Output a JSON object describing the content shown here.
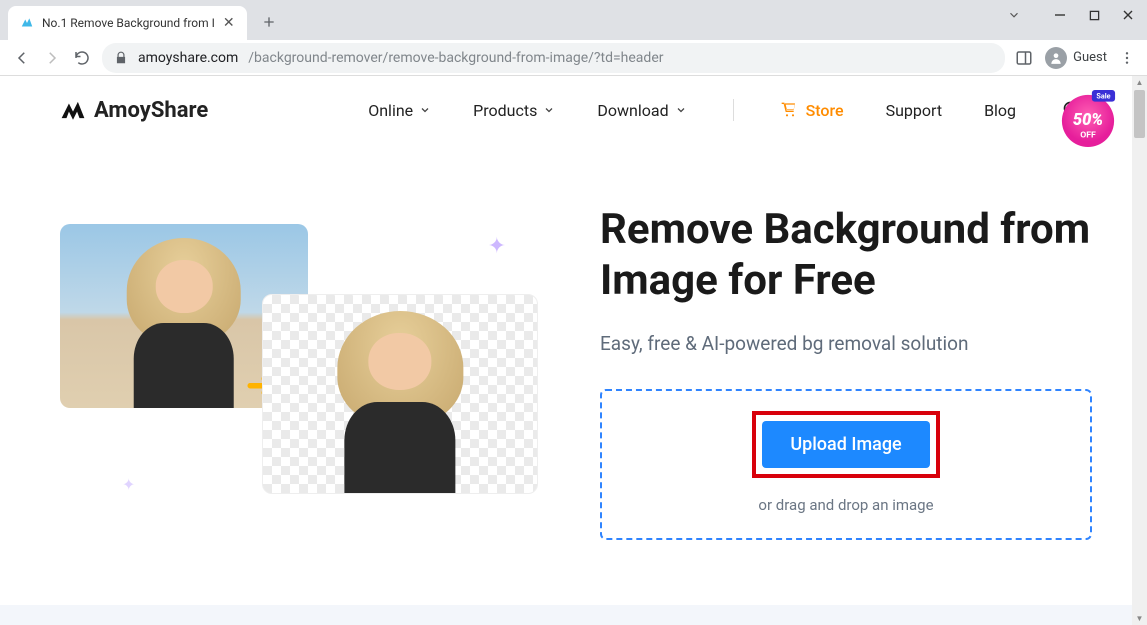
{
  "browser": {
    "tab_title": "No.1 Remove Background from I",
    "url_host": "amoyshare.com",
    "url_path": "/background-remover/remove-background-from-image/?td=header",
    "guest_label": "Guest"
  },
  "header": {
    "logo_text": "AmoyShare",
    "nav": {
      "online": "Online",
      "products": "Products",
      "download": "Download",
      "store": "Store",
      "support": "Support",
      "blog": "Blog"
    },
    "promo": {
      "tag": "Sale",
      "amount": "50%",
      "suffix": "OFF"
    }
  },
  "hero": {
    "headline": "Remove Background from Image for Free",
    "subhead": "Easy, free & AI-powered bg removal solution",
    "upload_label": "Upload Image",
    "drop_hint": "or drag and drop an image"
  }
}
